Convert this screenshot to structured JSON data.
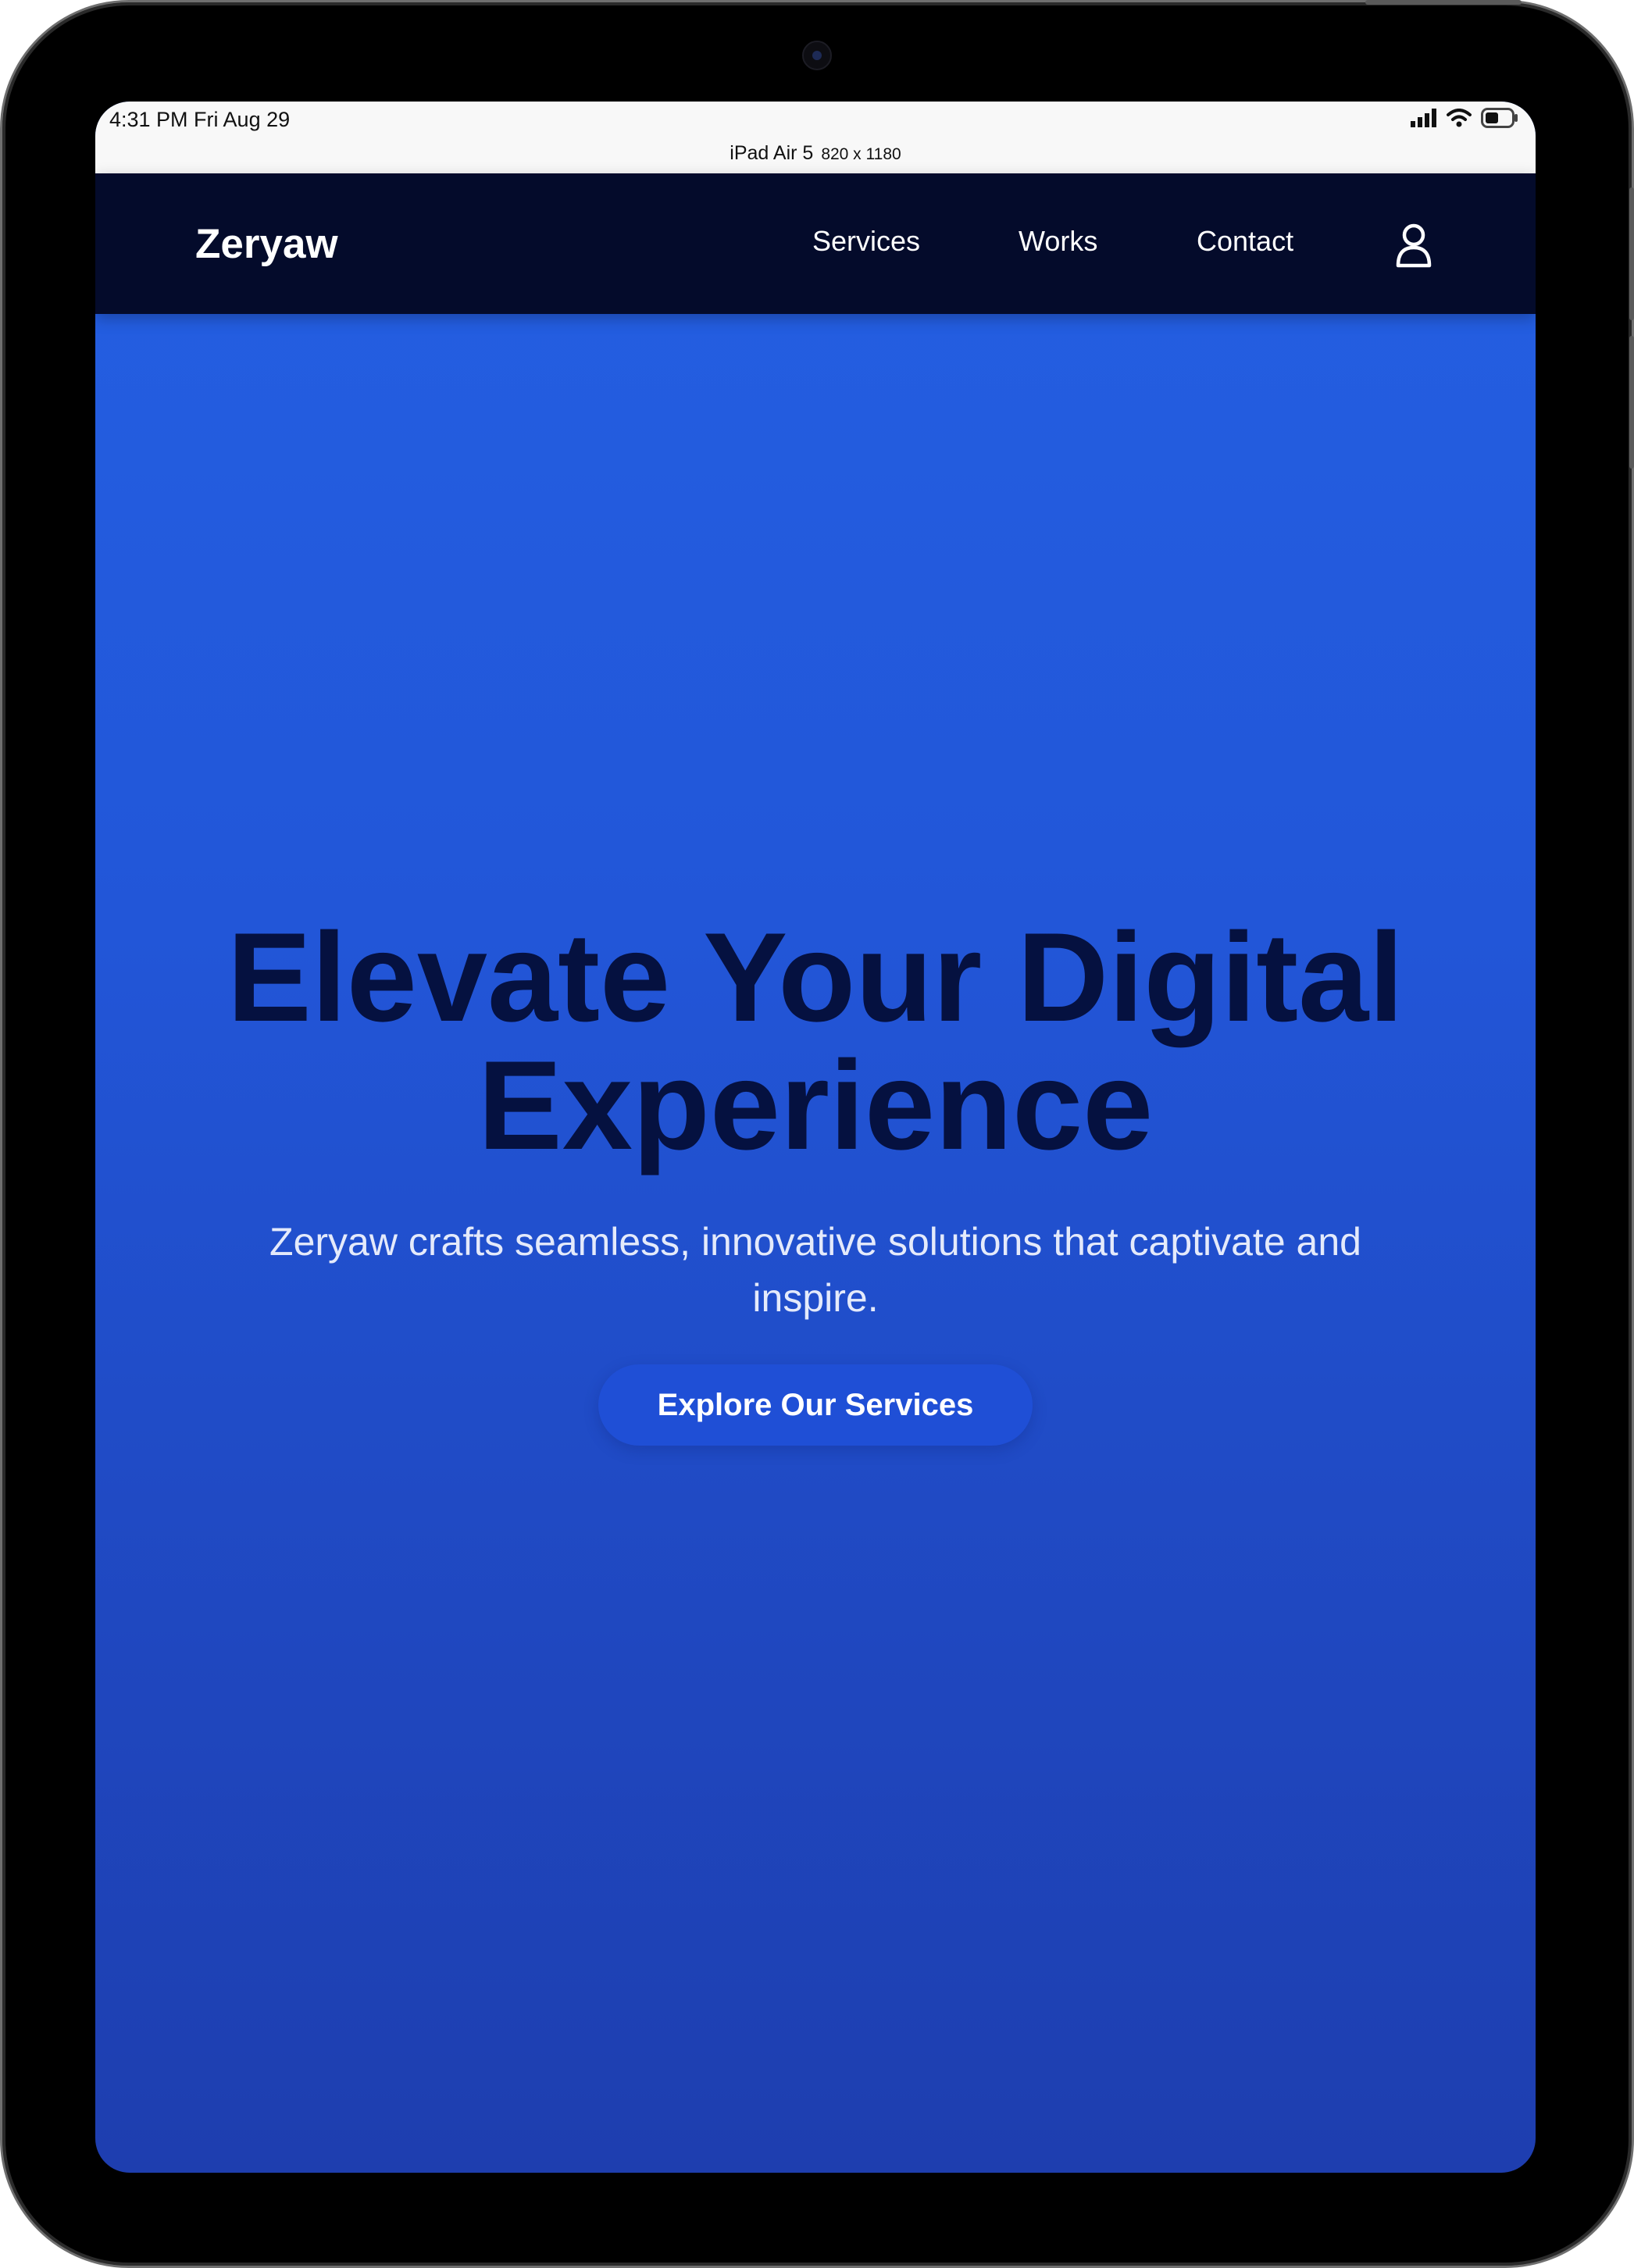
{
  "status_bar": {
    "time": "4:31 PM Fri Aug 29",
    "device_name": "iPad Air 5",
    "device_dims": "820 x 1180"
  },
  "nav": {
    "brand": "Zeryaw",
    "links": [
      {
        "label": "Services"
      },
      {
        "label": "Works"
      },
      {
        "label": "Contact"
      }
    ],
    "user_icon": "user-icon"
  },
  "hero": {
    "title_line1": "Elevate Your Digital",
    "title_line2": "Experience",
    "subtitle": "Zeryaw crafts seamless, innovative solutions that captivate and inspire.",
    "cta_label": "Explore Our Services"
  },
  "colors": {
    "navbar_bg": "#040b2b",
    "hero_top": "#2460e3",
    "hero_bottom": "#1e3eaf",
    "title_color": "#051140",
    "cta_bg": "#1f4fd6"
  }
}
